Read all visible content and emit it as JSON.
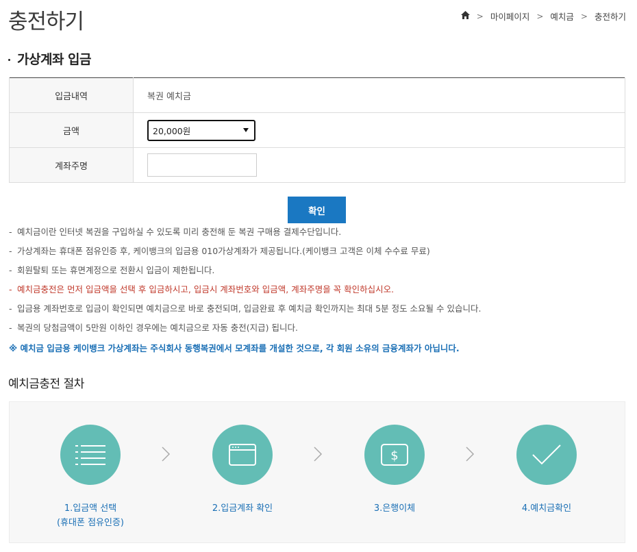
{
  "page_title": "충전하기",
  "breadcrumb": {
    "home_icon": "home-icon",
    "items": [
      "마이페이지",
      "예치금",
      "충전하기"
    ]
  },
  "section_title": "가상계좌 입금",
  "form": {
    "rows": [
      {
        "label": "입금내역",
        "value": "복권 예치금"
      },
      {
        "label": "금액",
        "selected": "20,000원"
      },
      {
        "label": "계좌주명",
        "value": ""
      }
    ]
  },
  "confirm_label": "확인",
  "notes": [
    "예치금이란 인터넷 복권을 구입하실 수 있도록 미리 충전해 둔 복권 구매용 결제수단입니다.",
    "가상계좌는 휴대폰 점유인증 후, 케이뱅크의 입금용 010가상계좌가 제공됩니다.(케이뱅크 고객은 이체 수수료 무료)",
    "회원탈퇴 또는 휴면계정으로 전환시 입금이 제한됩니다.",
    "예치금충전은 먼저 입금액을 선택 후 입금하시고, 입금시 계좌번호와 입금액, 계좌주명을 꼭 확인하십시오.",
    "입금용 계좌번호로 입금이 확인되면 예치금으로 바로 충전되며, 입금완료 후 예치금 확인까지는 최대 5분 정도 소요될 수 있습니다.",
    "복권의 당첨금액이 5만원 이하인 경우에는 예치금으로 자동 충전(지급) 됩니다."
  ],
  "notice": "※ 예치금 입금용 케이뱅크 가상계좌는 주식회사 동행복권에서 모계좌를 개설한 것으로, 각 회원 소유의 금융계좌가 아닙니다.",
  "process_title": "예치금충전 절차",
  "steps": [
    {
      "label": "1.입금액 선택",
      "sub": "(휴대폰 점유인증)",
      "icon": "list-icon"
    },
    {
      "label": "2.입금계좌 확인",
      "icon": "browser-window-icon"
    },
    {
      "label": "3.은행이체",
      "icon": "dollar-bill-icon"
    },
    {
      "label": "4.예치금확인",
      "icon": "checkmark-icon"
    }
  ],
  "colors": {
    "accent": "#1a78c2",
    "step_circle": "#63bdb5",
    "warn": "#c0392b",
    "notice": "#1a6fb5"
  }
}
